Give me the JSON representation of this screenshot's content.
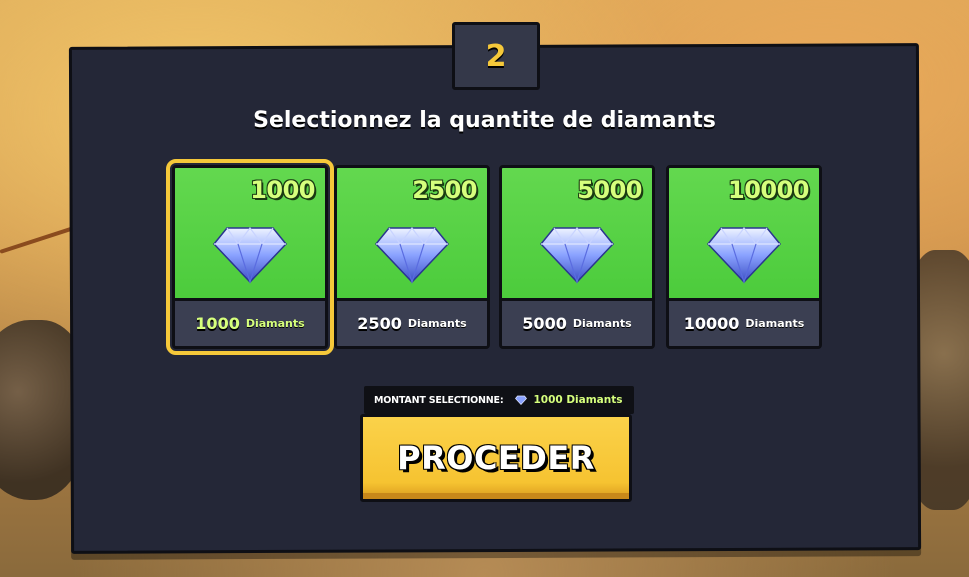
{
  "step": {
    "number": "2"
  },
  "title": "Selectionnez la quantite de diamants",
  "packages": [
    {
      "amount": "1000",
      "label_num": "1000",
      "label_unit": "Diamants",
      "selected": true
    },
    {
      "amount": "2500",
      "label_num": "2500",
      "label_unit": "Diamants",
      "selected": false
    },
    {
      "amount": "5000",
      "label_num": "5000",
      "label_unit": "Diamants",
      "selected": false
    },
    {
      "amount": "10000",
      "label_num": "10000",
      "label_unit": "Diamants",
      "selected": false
    }
  ],
  "selection": {
    "label": "MONTANT SELECTIONNE:",
    "value": "1000 Diamants",
    "icon": "diamond-icon"
  },
  "proceed_button": {
    "label": "PROCEDER"
  },
  "colors": {
    "panel": "#242737",
    "card_green": "#4bcb3b",
    "accent_yellow": "#f5c83a",
    "amount_green": "#d6ff7d"
  }
}
